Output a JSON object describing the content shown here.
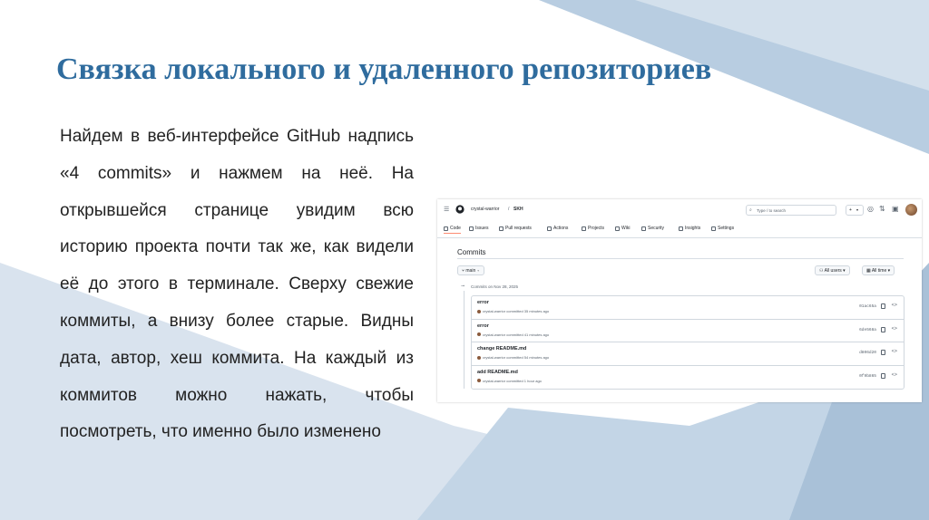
{
  "slide": {
    "title": "Связка локального и удаленного репозиториев",
    "body": "Найдем в веб-интерфейсе GitHub надпись «4 commits» и нажмем на неё. На открывшейся странице увидим всю историю проекта почти так же, как видели её до этого в терминале. Сверху свежие коммиты, а внизу более старые. Видны дата, автор, хеш коммита. На каждый из коммитов можно нажать, чтобы посмотреть, что именно было изменено"
  },
  "colors": {
    "title": "#2f6c9e",
    "bg_light": "#d9e3ee",
    "bg_mid": "#b8cde1",
    "bg_dark": "#9fb8d1"
  },
  "github": {
    "owner": "crystal-warrior",
    "separator": "/",
    "repo": "SKH",
    "search_placeholder": "Type / to search",
    "plus": "+",
    "tabs": [
      {
        "label": "Code",
        "icon": "code-icon"
      },
      {
        "label": "Issues",
        "icon": "issue-icon"
      },
      {
        "label": "Pull requests",
        "icon": "pull-request-icon"
      },
      {
        "label": "Actions",
        "icon": "play-icon"
      },
      {
        "label": "Projects",
        "icon": "table-icon"
      },
      {
        "label": "Wiki",
        "icon": "book-icon"
      },
      {
        "label": "Security",
        "icon": "shield-icon"
      },
      {
        "label": "Insights",
        "icon": "graph-icon"
      },
      {
        "label": "Settings",
        "icon": "gear-icon"
      }
    ],
    "page_title": "Commits",
    "branch": "main",
    "all_users": "All users",
    "all_time": "All time",
    "group_label": "Commits on Nov 28, 2025",
    "commits": [
      {
        "message": "error",
        "meta": "crystal-warrior committed 35 minutes ago",
        "sha": "01ac65a"
      },
      {
        "message": "error",
        "meta": "crystal-warrior committed 41 minutes ago",
        "sha": "6de568a"
      },
      {
        "message": "change README.md",
        "meta": "crystal-warrior committed 54 minutes ago",
        "sha": "d806d20"
      },
      {
        "message": "add README.md",
        "meta": "crystal-warrior committed 1 hour ago",
        "sha": "0f9b865"
      }
    ]
  }
}
